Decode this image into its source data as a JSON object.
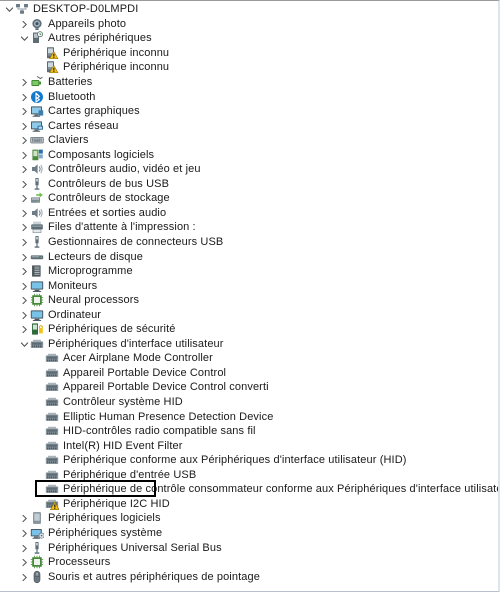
{
  "window": {
    "name": "device-manager-tree",
    "accent_warning": "#f0c419",
    "accent_selection_box": "#000000",
    "background": "#ffffff"
  },
  "tree": {
    "root": {
      "label": "DESKTOP-D0LMPDI",
      "icon": "computer-network-icon",
      "level": 0,
      "expanded": true
    },
    "nodes": [
      {
        "label": "Appareils photo",
        "icon": "camera-icon",
        "level": 1,
        "twisty": "collapsed"
      },
      {
        "label": "Autres périphériques",
        "icon": "other-devices-icon",
        "level": 1,
        "twisty": "expanded"
      },
      {
        "label": "Périphérique inconnu",
        "icon": "unknown-device-warning-icon",
        "level": 2,
        "twisty": "none"
      },
      {
        "label": "Périphérique inconnu",
        "icon": "unknown-device-warning-icon",
        "level": 2,
        "twisty": "none"
      },
      {
        "label": "Batteries",
        "icon": "battery-icon",
        "level": 1,
        "twisty": "collapsed"
      },
      {
        "label": "Bluetooth",
        "icon": "bluetooth-icon",
        "level": 1,
        "twisty": "collapsed"
      },
      {
        "label": "Cartes graphiques",
        "icon": "display-adapter-icon",
        "level": 1,
        "twisty": "collapsed"
      },
      {
        "label": "Cartes réseau",
        "icon": "network-adapter-icon",
        "level": 1,
        "twisty": "collapsed"
      },
      {
        "label": "Claviers",
        "icon": "keyboard-icon",
        "level": 1,
        "twisty": "collapsed"
      },
      {
        "label": "Composants logiciels",
        "icon": "software-component-icon",
        "level": 1,
        "twisty": "collapsed"
      },
      {
        "label": "Contrôleurs audio, vidéo et jeu",
        "icon": "speaker-icon",
        "level": 1,
        "twisty": "collapsed"
      },
      {
        "label": "Contrôleurs de bus USB",
        "icon": "usb-icon",
        "level": 1,
        "twisty": "collapsed"
      },
      {
        "label": "Contrôleurs de stockage",
        "icon": "storage-controller-icon",
        "level": 1,
        "twisty": "collapsed"
      },
      {
        "label": "Entrées et sorties audio",
        "icon": "speaker-icon",
        "level": 1,
        "twisty": "collapsed"
      },
      {
        "label": "Files d'attente à l'impression :",
        "icon": "printer-icon",
        "level": 1,
        "twisty": "collapsed"
      },
      {
        "label": "Gestionnaires de connecteurs USB",
        "icon": "usb-icon",
        "level": 1,
        "twisty": "collapsed"
      },
      {
        "label": "Lecteurs de disque",
        "icon": "disk-drive-icon",
        "level": 1,
        "twisty": "collapsed"
      },
      {
        "label": "Microprogramme",
        "icon": "firmware-icon",
        "level": 1,
        "twisty": "collapsed"
      },
      {
        "label": "Moniteurs",
        "icon": "monitor-icon",
        "level": 1,
        "twisty": "collapsed"
      },
      {
        "label": "Neural processors",
        "icon": "processor-icon",
        "level": 1,
        "twisty": "collapsed"
      },
      {
        "label": "Ordinateur",
        "icon": "monitor-icon",
        "level": 1,
        "twisty": "collapsed"
      },
      {
        "label": "Périphériques de sécurité",
        "icon": "security-device-icon",
        "level": 1,
        "twisty": "collapsed"
      },
      {
        "label": "Périphériques d'interface utilisateur",
        "icon": "hid-icon",
        "level": 1,
        "twisty": "expanded"
      },
      {
        "label": "Acer Airplane Mode Controller",
        "icon": "hid-icon",
        "level": 2,
        "twisty": "none"
      },
      {
        "label": "Appareil Portable Device Control",
        "icon": "hid-icon",
        "level": 2,
        "twisty": "none"
      },
      {
        "label": "Appareil Portable Device Control converti",
        "icon": "hid-icon",
        "level": 2,
        "twisty": "none"
      },
      {
        "label": "Contrôleur système HID",
        "icon": "hid-icon",
        "level": 2,
        "twisty": "none"
      },
      {
        "label": "Elliptic Human Presence Detection Device",
        "icon": "hid-icon",
        "level": 2,
        "twisty": "none"
      },
      {
        "label": "HID-contrôles radio compatible sans fil",
        "icon": "hid-icon",
        "level": 2,
        "twisty": "none"
      },
      {
        "label": "Intel(R) HID Event Filter",
        "icon": "hid-icon",
        "level": 2,
        "twisty": "none"
      },
      {
        "label": "Périphérique conforme aux Périphériques d'interface utilisateur (HID)",
        "icon": "hid-icon",
        "level": 2,
        "twisty": "none"
      },
      {
        "label": "Périphérique d'entrée USB",
        "icon": "hid-icon",
        "level": 2,
        "twisty": "none"
      },
      {
        "label": "Périphérique de contrôle consommateur conforme aux Périphériques d'interface utilisateur (HID)",
        "icon": "hid-icon",
        "level": 2,
        "twisty": "none"
      },
      {
        "label": "Périphérique I2C HID",
        "icon": "hid-warning-icon",
        "level": 2,
        "twisty": "none",
        "highlighted": true
      },
      {
        "label": "Périphériques logiciels",
        "icon": "software-device-icon",
        "level": 1,
        "twisty": "collapsed"
      },
      {
        "label": "Périphériques système",
        "icon": "system-device-icon",
        "level": 1,
        "twisty": "collapsed"
      },
      {
        "label": "Périphériques Universal Serial Bus",
        "icon": "usb-icon",
        "level": 1,
        "twisty": "collapsed"
      },
      {
        "label": "Processeurs",
        "icon": "processor-icon",
        "level": 1,
        "twisty": "collapsed"
      },
      {
        "label": "Souris et autres périphériques de pointage",
        "icon": "mouse-icon",
        "level": 1,
        "twisty": "collapsed"
      }
    ]
  }
}
